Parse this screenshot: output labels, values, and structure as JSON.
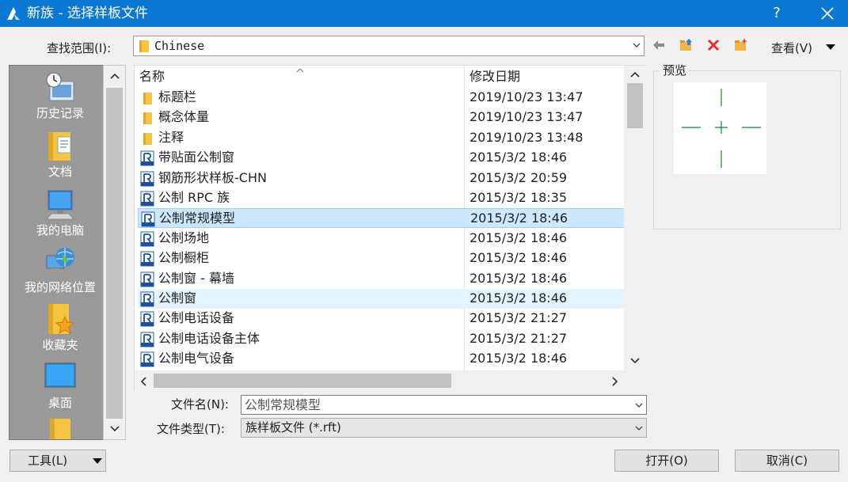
{
  "window": {
    "title": "新族 - 选择样板文件",
    "help": "?"
  },
  "lookin": {
    "label": "查找范围(I):",
    "value": "Chinese"
  },
  "toolbar": {
    "view_label": "查看(V)"
  },
  "places": [
    {
      "label": "历史记录",
      "icon": "history-icon"
    },
    {
      "label": "文档",
      "icon": "documents-icon"
    },
    {
      "label": "我的电脑",
      "icon": "computer-icon"
    },
    {
      "label": "我的网络位置",
      "icon": "network-icon"
    },
    {
      "label": "收藏夹",
      "icon": "favorites-icon"
    },
    {
      "label": "桌面",
      "icon": "desktop-icon"
    }
  ],
  "filelist": {
    "col_name": "名称",
    "col_date": "修改日期",
    "rows": [
      {
        "name": "标题栏",
        "date": "2019/10/23 13:47",
        "type": "folder"
      },
      {
        "name": "概念体量",
        "date": "2019/10/23 13:47",
        "type": "folder"
      },
      {
        "name": "注释",
        "date": "2019/10/23 13:48",
        "type": "folder"
      },
      {
        "name": "带贴面公制窗",
        "date": "2015/3/2 18:46",
        "type": "rft"
      },
      {
        "name": "钢筋形状样板-CHN",
        "date": "2015/3/2 20:59",
        "type": "rft"
      },
      {
        "name": "公制 RPC 族",
        "date": "2015/3/2 18:35",
        "type": "rft"
      },
      {
        "name": "公制常规模型",
        "date": "2015/3/2 18:46",
        "type": "rft"
      },
      {
        "name": "公制场地",
        "date": "2015/3/2 18:46",
        "type": "rft"
      },
      {
        "name": "公制橱柜",
        "date": "2015/3/2 18:46",
        "type": "rft"
      },
      {
        "name": "公制窗 - 幕墙",
        "date": "2015/3/2 18:46",
        "type": "rft"
      },
      {
        "name": "公制窗",
        "date": "2015/3/2 18:46",
        "type": "rft"
      },
      {
        "name": "公制电话设备",
        "date": "2015/3/2 21:27",
        "type": "rft"
      },
      {
        "name": "公制电话设备主体",
        "date": "2015/3/2 21:27",
        "type": "rft"
      },
      {
        "name": "公制电气设备",
        "date": "2015/3/2 18:46",
        "type": "rft"
      }
    ]
  },
  "preview": {
    "label": "预览"
  },
  "filename": {
    "label": "文件名(N):",
    "value": "公制常规模型"
  },
  "filetype": {
    "label": "文件类型(T):",
    "value": "族样板文件 (*.rft)"
  },
  "buttons": {
    "tools": "工具(L)",
    "open": "打开(O)",
    "cancel": "取消(C)"
  }
}
